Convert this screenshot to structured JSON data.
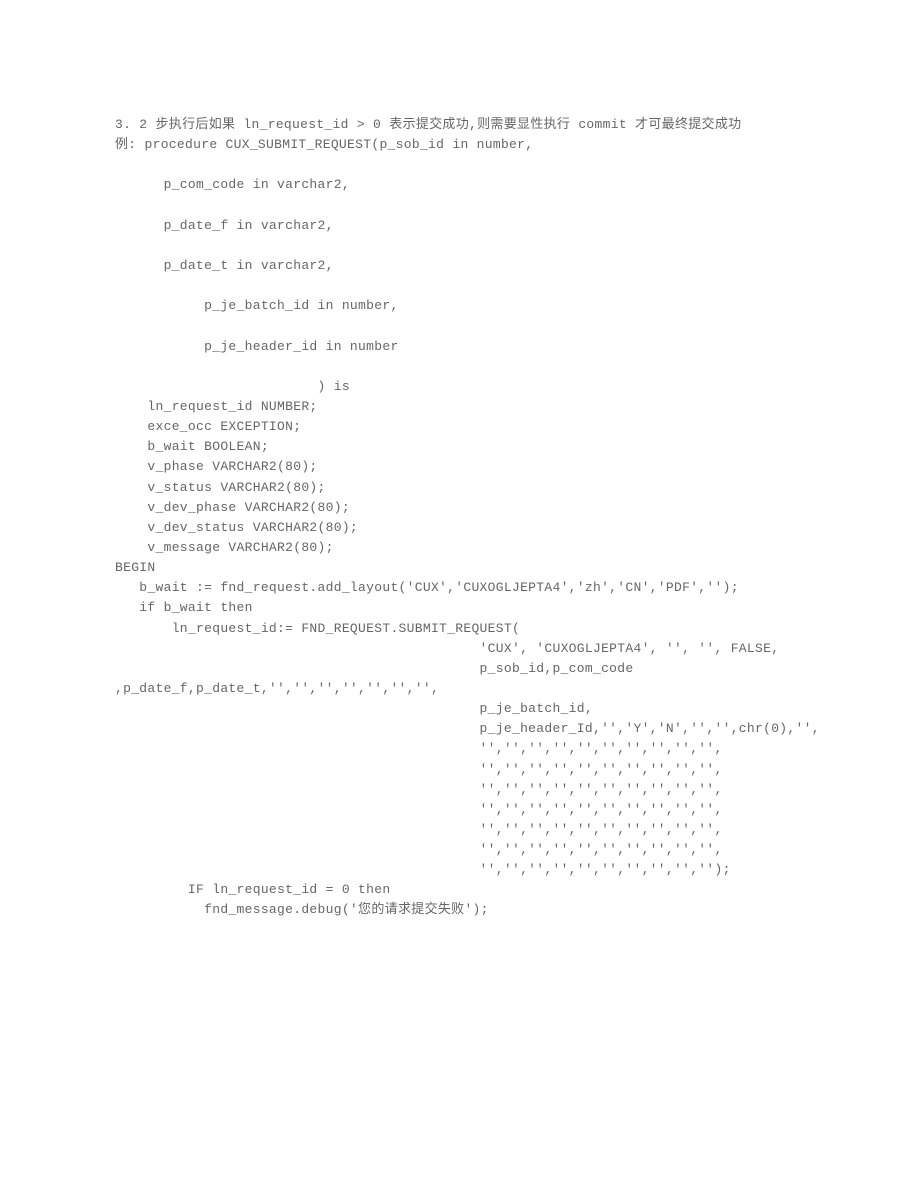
{
  "lines": [
    {
      "t": "3. 2 步执行后如果 ln_request_id > 0 表示提交成功,则需要显性执行 commit 才可最终提交成功"
    },
    {
      "t": "例: procedure CUX_SUBMIT_REQUEST(p_sob_id in number,"
    },
    {
      "t": ""
    },
    {
      "t": "      p_com_code in varchar2,"
    },
    {
      "t": ""
    },
    {
      "t": "      p_date_f in varchar2,"
    },
    {
      "t": ""
    },
    {
      "t": "      p_date_t in varchar2,"
    },
    {
      "t": ""
    },
    {
      "t": "           p_je_batch_id in number,"
    },
    {
      "t": ""
    },
    {
      "t": "           p_je_header_id in number"
    },
    {
      "t": ""
    },
    {
      "t": "                         ) is"
    },
    {
      "t": "    ln_request_id NUMBER;"
    },
    {
      "t": "    exce_occ EXCEPTION;"
    },
    {
      "t": "    b_wait BOOLEAN;"
    },
    {
      "t": "    v_phase VARCHAR2(80);"
    },
    {
      "t": "    v_status VARCHAR2(80);"
    },
    {
      "t": "    v_dev_phase VARCHAR2(80);"
    },
    {
      "t": "    v_dev_status VARCHAR2(80);"
    },
    {
      "t": "    v_message VARCHAR2(80);"
    },
    {
      "t": "BEGIN"
    },
    {
      "t": "   b_wait := fnd_request.add_layout('CUX','CUXOGLJEPTA4','zh','CN','PDF','');"
    },
    {
      "t": "   if b_wait then"
    },
    {
      "t": "       ln_request_id:= FND_REQUEST.SUBMIT_REQUEST("
    },
    {
      "t": "                                             'CUX', 'CUXOGLJEPTA4', '', '', FALSE,"
    },
    {
      "t": "                                             p_sob_id,p_com_code"
    },
    {
      "t": ",p_date_f,p_date_t,'','','','','','','',"
    },
    {
      "t": "                                             p_je_batch_id,"
    },
    {
      "t": "                                             p_je_header_Id,'','Y','N','','',chr(0),'',"
    },
    {
      "t": "                                             '','','','','','','','','','',"
    },
    {
      "t": "                                             '','','','','','','','','','',"
    },
    {
      "t": "                                             '','','','','','','','','','',"
    },
    {
      "t": "                                             '','','','','','','','','','',"
    },
    {
      "t": "                                             '','','','','','','','','','',"
    },
    {
      "t": "                                             '','','','','','','','','','',"
    },
    {
      "t": "                                             '','','','','','','','','','');"
    },
    {
      "t": "         IF ln_request_id = 0 then"
    },
    {
      "t": "           fnd_message.debug('您的请求提交失败');"
    }
  ]
}
